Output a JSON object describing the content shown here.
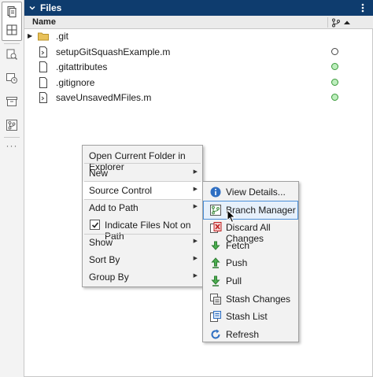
{
  "toolstrip": {
    "items": [
      {
        "icon": "file-browser-icon"
      },
      {
        "icon": "layout-grid-icon"
      },
      {
        "icon": "find-files-icon"
      },
      {
        "icon": "history-icon"
      },
      {
        "icon": "archive-icon"
      },
      {
        "icon": "source-control-icon"
      }
    ],
    "more": "···"
  },
  "panel": {
    "title": "Files",
    "columns": {
      "name": "Name"
    }
  },
  "files": [
    {
      "name": ".git",
      "kind": "folder",
      "expandable": true,
      "status": ""
    },
    {
      "name": "setupGitSquashExample.m",
      "kind": "script",
      "expandable": false,
      "status": "untracked"
    },
    {
      "name": ".gitattributes",
      "kind": "file",
      "expandable": false,
      "status": "committed"
    },
    {
      "name": ".gitignore",
      "kind": "file",
      "expandable": false,
      "status": "committed"
    },
    {
      "name": "saveUnsavedMFiles.m",
      "kind": "script",
      "expandable": false,
      "status": "committed"
    }
  ],
  "context_menu": {
    "items": [
      {
        "label": "Open Current Folder in Explorer",
        "has_submenu": false
      },
      {
        "label": "New",
        "has_submenu": true
      },
      {
        "label": "Source Control",
        "has_submenu": true,
        "selected": true
      },
      {
        "label": "Add to Path",
        "has_submenu": true
      },
      {
        "label": "Indicate Files Not on Path",
        "checkbox": true,
        "checked": true
      },
      {
        "label": "Show",
        "has_submenu": true
      },
      {
        "label": "Sort By",
        "has_submenu": true
      },
      {
        "label": "Group By",
        "has_submenu": true
      }
    ]
  },
  "source_control_menu": {
    "items": [
      {
        "label": "View Details...",
        "icon": "info-icon"
      },
      {
        "label": "Branch Manager",
        "icon": "branch-manager-icon",
        "hover": true
      },
      {
        "label": "Discard All Changes",
        "icon": "discard-changes-icon"
      },
      {
        "label": "Fetch",
        "icon": "fetch-icon"
      },
      {
        "label": "Push",
        "icon": "push-icon"
      },
      {
        "label": "Pull",
        "icon": "pull-icon"
      },
      {
        "label": "Stash Changes",
        "icon": "stash-changes-icon"
      },
      {
        "label": "Stash List",
        "icon": "stash-list-icon"
      },
      {
        "label": "Refresh",
        "icon": "refresh-icon"
      }
    ]
  },
  "colors": {
    "header_bg": "#0e3c6e",
    "status_committed": "#3a9a3a",
    "status_untracked": "#444444",
    "hover_border": "#4a8fd8"
  }
}
